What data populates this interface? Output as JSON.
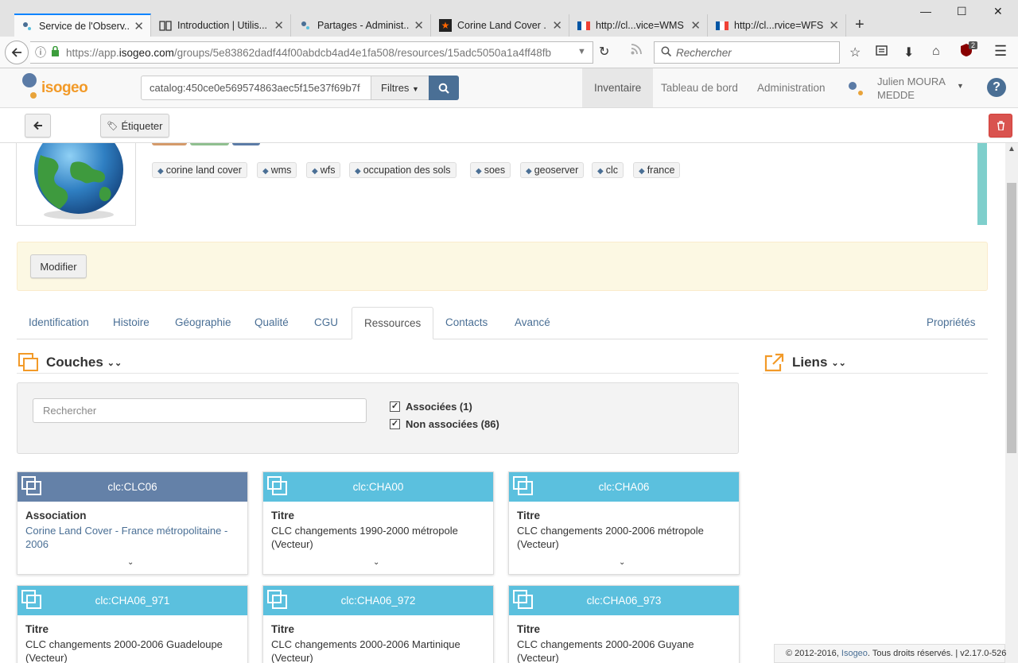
{
  "browser": {
    "tabs": [
      {
        "title": "Service de l'Observ...",
        "active": true
      },
      {
        "title": "Introduction | Utilis...",
        "active": false
      },
      {
        "title": "Partages - Administ...",
        "active": false
      },
      {
        "title": "Corine Land Cover ...",
        "active": false
      },
      {
        "title": "http://cl...vice=WMS",
        "active": false
      },
      {
        "title": "http://cl...rvice=WFS",
        "active": false
      }
    ],
    "url_prefix": "https://app.",
    "url_host": "isogeo.com",
    "url_path": "/groups/5e83862dadf44f00abdcb4ad4e1fa508/resources/15adc5050a1a4ff48fb",
    "search_placeholder": "Rechercher",
    "ext_badge": "2"
  },
  "app": {
    "logo_text": "isogeo",
    "catalog_query": "catalog:450ce0e569574863aec5f15e37f69b7f",
    "filters_label": "Filtres",
    "nav": [
      "Inventaire",
      "Tableau de bord",
      "Administration"
    ],
    "user_name": "Julien MOURA",
    "user_org": "MEDDE",
    "help": "?"
  },
  "actions": {
    "tag_button": "Étiqueter"
  },
  "resource": {
    "keywords": [
      "corine land cover",
      "wms",
      "wfs",
      "occupation des sols",
      "soes",
      "geoserver",
      "clc",
      "france"
    ],
    "edit_button": "Modifier"
  },
  "tabs": [
    "Identification",
    "Histoire",
    "Géographie",
    "Qualité",
    "CGU",
    "Ressources",
    "Contacts",
    "Avancé"
  ],
  "tab_right": "Propriétés",
  "layers": {
    "title": "Couches",
    "search_placeholder": "Rechercher",
    "filter_associated": "Associées (1)",
    "filter_not_associated": "Non associées (86)",
    "cards": [
      {
        "name": "clc:CLC06",
        "label": "Association",
        "value": "Corine Land Cover - France métropolitaine - 2006"
      },
      {
        "name": "clc:CHA00",
        "label": "Titre",
        "value": "CLC changements 1990-2000 métropole (Vecteur)"
      },
      {
        "name": "clc:CHA06",
        "label": "Titre",
        "value": "CLC changements 2000-2006 métropole (Vecteur)"
      },
      {
        "name": "clc:CHA06_971",
        "label": "Titre",
        "value": "CLC changements 2000-2006 Guadeloupe (Vecteur)"
      },
      {
        "name": "clc:CHA06_972",
        "label": "Titre",
        "value": "CLC changements 2000-2006 Martinique (Vecteur)"
      },
      {
        "name": "clc:CHA06_973",
        "label": "Titre",
        "value": "CLC changements 2000-2006 Guyane (Vecteur)"
      }
    ]
  },
  "links": {
    "title": "Liens"
  },
  "footer": {
    "copyright": "© 2012-2016,",
    "brand": "Isogeo",
    "rights": ". Tous droits réservés. | v2.17.0-526"
  },
  "colors": {
    "primary": "#4a6f95",
    "card_header": "#5bc0de",
    "card_header_selected": "#6481a8",
    "accent_orange": "#f29a28",
    "danger": "#d9534f"
  }
}
